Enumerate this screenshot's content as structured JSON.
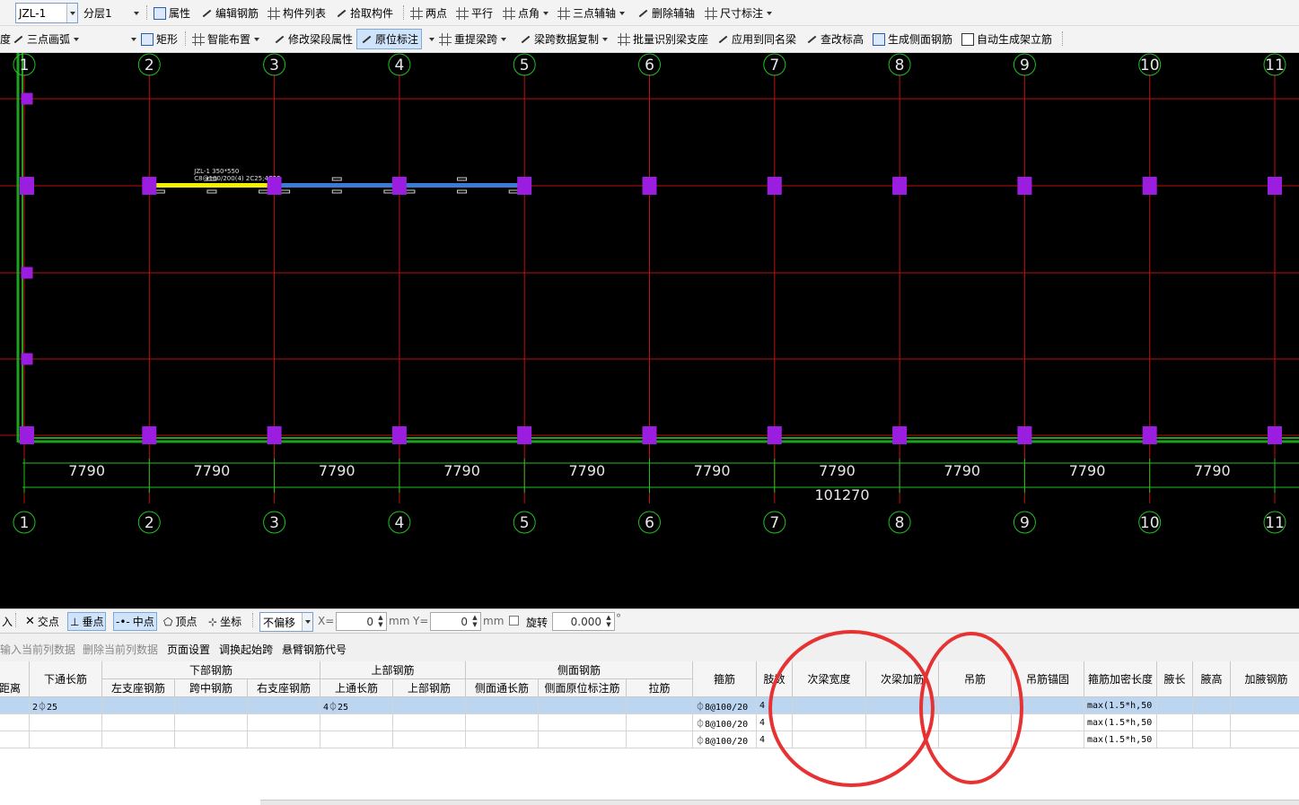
{
  "toolbar1": {
    "element_select": "JZL-1",
    "floor_select": "分层1",
    "items": [
      "属性",
      "编辑钢筋",
      "构件列表",
      "拾取构件",
      "两点",
      "平行",
      "点角",
      "三点辅轴",
      "删除辅轴",
      "尺寸标注"
    ]
  },
  "toolbar2": {
    "left_fragment": "度",
    "arc_select": "三点画弧",
    "items": [
      "矩形",
      "智能布置",
      "修改梁段属性",
      "原位标注",
      "重提梁跨",
      "梁跨数据复制",
      "批量识别梁支座",
      "应用到同名梁",
      "查改标高",
      "生成侧面钢筋",
      "自动生成架立筋"
    ]
  },
  "canvas": {
    "axis_labels": [
      "1",
      "2",
      "3",
      "4",
      "5",
      "6",
      "7",
      "8",
      "9",
      "10",
      "11"
    ],
    "spans": [
      "7790",
      "7790",
      "7790",
      "7790",
      "7790",
      "7790",
      "7790",
      "7790",
      "7790",
      "7790"
    ],
    "total_length": "101270",
    "beam_label_line1": "JZL-1 350*550",
    "beam_label_line2": "C8@100/200(4) 2C25;4C25",
    "colors": {
      "background": "#000000",
      "axis": "#c01010",
      "column": "#9b1de0",
      "beam_selected": "#f5f000",
      "beam": "#3a7bd5",
      "wall": "#1fa01f",
      "dim": "#20c020"
    }
  },
  "snapbar": {
    "items": [
      "入",
      "交点",
      "垂点",
      "中点",
      "顶点",
      "坐标"
    ],
    "offset_select": "不偏移",
    "x_label": "X=",
    "x_value": "0",
    "y_label": "Y=",
    "y_value": "0",
    "unit": "mm",
    "rotate_label": "旋转",
    "rotate_value": "0.000",
    "degree": "°"
  },
  "actions": [
    "输入当前列数据",
    "删除当前列数据",
    "页面设置",
    "调换起始跨",
    "悬臂钢筋代号"
  ],
  "grid": {
    "headers_top": [
      "距离",
      "下通长筋",
      "下部钢筋",
      "上部钢筋",
      "侧面钢筋",
      "箍筋",
      "肢数",
      "次梁宽度",
      "次梁加筋",
      "吊筋",
      "吊筋锚固",
      "箍筋加密长度",
      "腋长",
      "腋高",
      "加腋钢筋"
    ],
    "headers_sub": [
      "左支座钢筋",
      "跨中钢筋",
      "右支座钢筋",
      "上通长筋",
      "上部钢筋",
      "侧面通长筋",
      "侧面原位标注筋",
      "拉筋"
    ],
    "rows": [
      {
        "bottom_long": "2⏀25",
        "top_long": "4⏀25",
        "stirrup": "⏀8@100/20",
        "legs": "4",
        "dense_len": "max(1.5*h,50"
      },
      {
        "bottom_long": "",
        "top_long": "",
        "stirrup": "⏀8@100/20",
        "legs": "4",
        "dense_len": "max(1.5*h,50"
      },
      {
        "bottom_long": "",
        "top_long": "",
        "stirrup": "⏀8@100/20",
        "legs": "4",
        "dense_len": "max(1.5*h,50"
      }
    ]
  }
}
